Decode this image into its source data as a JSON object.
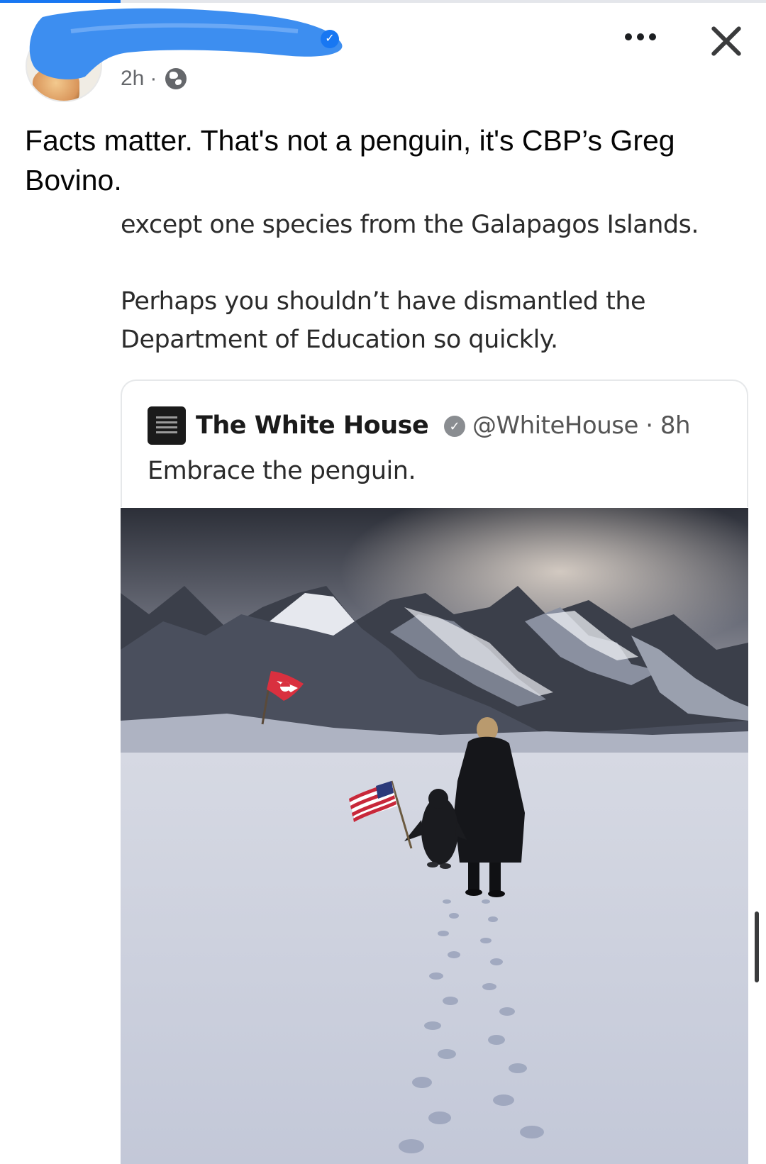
{
  "post": {
    "time": "2h",
    "time_separator": "·",
    "caption": "Facts matter. That's not a penguin, it's CBP’s Greg Bovino."
  },
  "header": {
    "more_icon": "more-horizontal-icon",
    "close_icon": "close-icon",
    "verified_icon": "verified-badge-icon",
    "privacy_icon": "globe-icon"
  },
  "shared": {
    "line1": "except one species from the Galapagos Islands.",
    "para2": "Perhaps you shouldn’t have dismantled the Department of Education so quickly."
  },
  "tweet": {
    "author": "The White House",
    "handle": "@WhiteHouse · 8h",
    "text": "Embrace the penguin.",
    "verified_icon": "verified-badge-icon"
  },
  "colors": {
    "accent": "#1877f2",
    "redaction": "#3d8ef0",
    "text_primary": "#050505",
    "text_secondary": "#65676b"
  }
}
